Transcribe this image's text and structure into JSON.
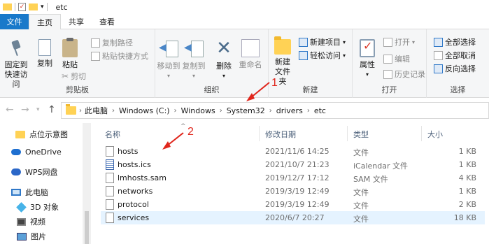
{
  "window": {
    "title": "etc"
  },
  "tabs": [
    "文件",
    "主页",
    "共享",
    "查看"
  ],
  "ribbon": {
    "clipboard": {
      "pin_label": "固定到快速访问",
      "copy_label": "复制",
      "paste_label": "粘贴",
      "copy_path": "复制路径",
      "paste_shortcut": "粘贴快捷方式",
      "cut": "剪切",
      "group_label": "剪贴板"
    },
    "organize": {
      "move_to": "移动到",
      "copy_to": "复制到",
      "delete": "删除",
      "rename": "重命名",
      "group_label": "组织"
    },
    "new": {
      "new_folder": "新建文件夹",
      "new_item": "新建项目",
      "easy_access": "轻松访问",
      "group_label": "新建"
    },
    "open": {
      "properties": "属性",
      "open": "打开",
      "edit": "编辑",
      "history": "历史记录",
      "group_label": "打开"
    },
    "select": {
      "select_all": "全部选择",
      "select_none": "全部取消",
      "invert": "反向选择",
      "group_label": "选择"
    }
  },
  "address": {
    "crumbs": [
      "此电脑",
      "Windows (C:)",
      "Windows",
      "System32",
      "drivers",
      "etc"
    ]
  },
  "nav_pane": {
    "items": [
      "点位示意图",
      "OneDrive",
      "WPS网盘",
      "此电脑",
      "3D 对象",
      "视频",
      "图片"
    ]
  },
  "file_list": {
    "columns": {
      "name": "名称",
      "date": "修改日期",
      "type": "类型",
      "size": "大小"
    },
    "rows": [
      {
        "name": "hosts",
        "date": "2021/11/6 14:25",
        "type": "文件",
        "size": "1 KB",
        "icon": "file-icon"
      },
      {
        "name": "hosts.ics",
        "date": "2021/10/7 21:23",
        "type": "iCalendar 文件",
        "size": "1 KB",
        "icon": "calendar-file-icon"
      },
      {
        "name": "lmhosts.sam",
        "date": "2019/12/7 17:12",
        "type": "SAM 文件",
        "size": "4 KB",
        "icon": "file-icon"
      },
      {
        "name": "networks",
        "date": "2019/3/19 12:49",
        "type": "文件",
        "size": "1 KB",
        "icon": "file-icon"
      },
      {
        "name": "protocol",
        "date": "2019/3/19 12:49",
        "type": "文件",
        "size": "2 KB",
        "icon": "file-icon"
      },
      {
        "name": "services",
        "date": "2020/6/7 20:27",
        "type": "文件",
        "size": "18 KB",
        "icon": "file-icon"
      }
    ]
  },
  "annotations": {
    "one": "1",
    "two": "2",
    "color": "#e0261c"
  }
}
